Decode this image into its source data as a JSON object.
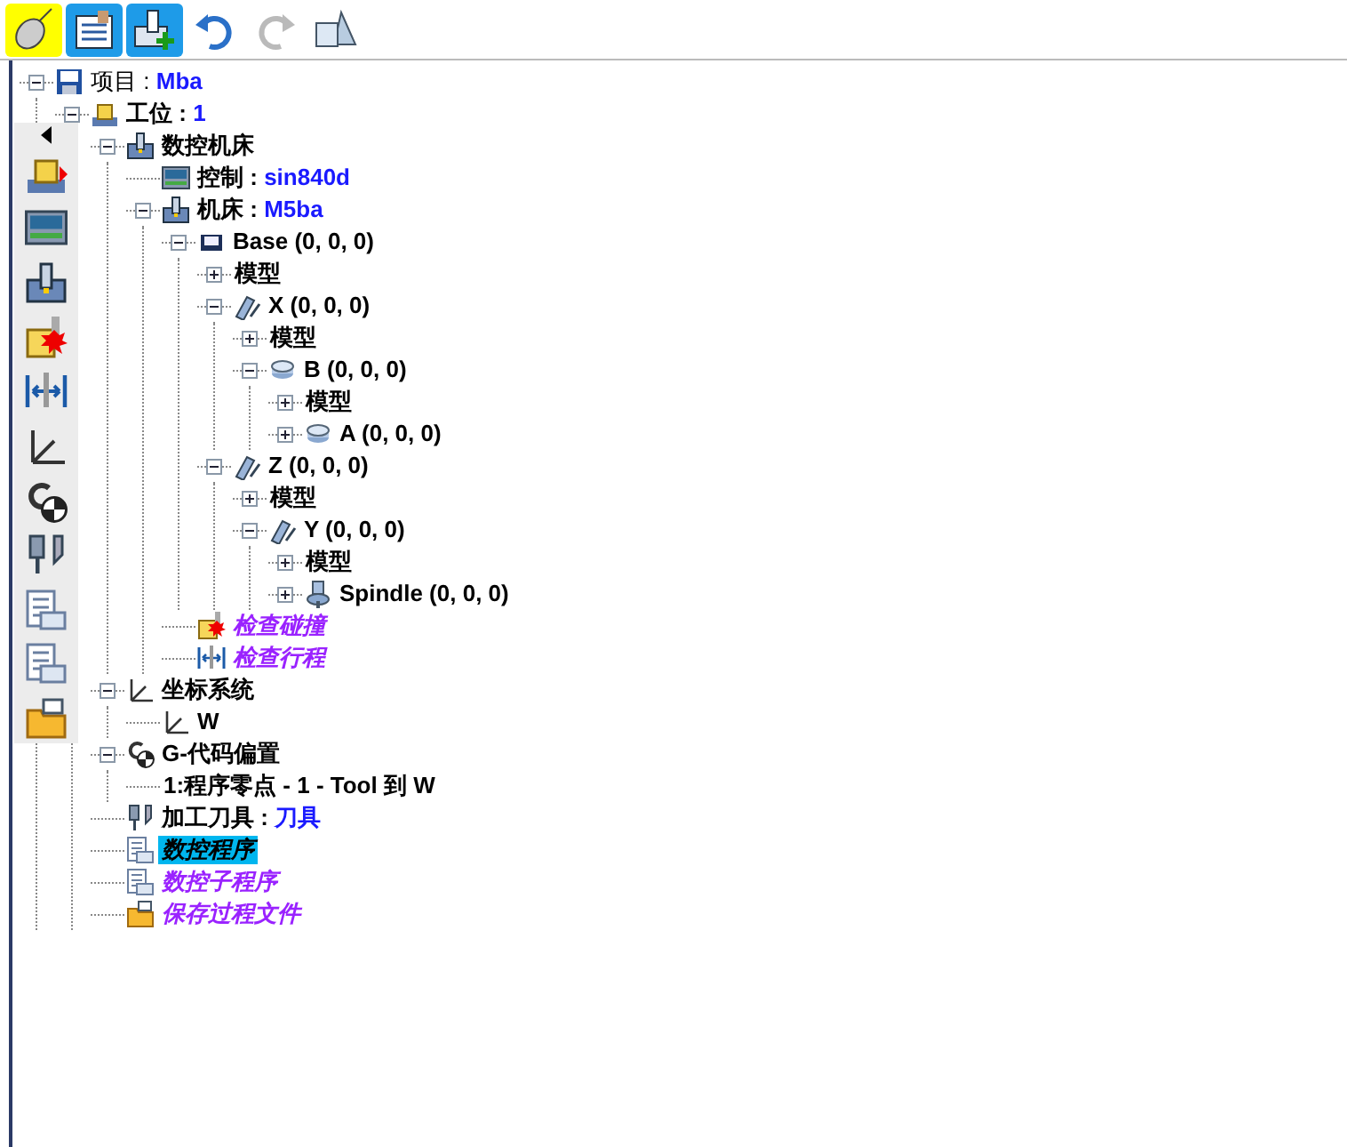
{
  "toolbar": [
    {
      "kind": "mouse",
      "on": true,
      "disabled": false
    },
    {
      "kind": "document",
      "on": false,
      "disabled": false
    },
    {
      "kind": "add-machine",
      "on": false,
      "disabled": false
    },
    {
      "kind": "undo",
      "on": false,
      "disabled": false
    },
    {
      "kind": "redo",
      "on": false,
      "disabled": true
    },
    {
      "kind": "shapes",
      "on": false,
      "disabled": false
    }
  ],
  "tree": [
    {
      "kind": "project",
      "label": "项目 :",
      "value": "Mba",
      "selected": false,
      "expanded": true,
      "children": [
        {
          "kind": "station",
          "label": "工位 :",
          "value": "1",
          "selected": false,
          "expanded": true,
          "children": [
            {
              "kind": "machine",
              "label": "数控机床",
              "selected": false,
              "expanded": true,
              "children": [
                {
                  "kind": "controller",
                  "label": "控制 :",
                  "value": "sin840d",
                  "selected": false
                },
                {
                  "kind": "machine",
                  "label": "机床 :",
                  "value": "M5ba",
                  "selected": false,
                  "expanded": true,
                  "children": [
                    {
                      "kind": "base",
                      "label": "Base (0, 0, 0)",
                      "selected": false,
                      "expanded": true,
                      "children": [
                        {
                          "kind": "model",
                          "label": "模型",
                          "selected": false,
                          "expanded": false
                        },
                        {
                          "kind": "linear",
                          "label": "X (0, 0, 0)",
                          "selected": false,
                          "expanded": true,
                          "children": [
                            {
                              "kind": "model",
                              "label": "模型",
                              "selected": false,
                              "expanded": false
                            },
                            {
                              "kind": "rotary",
                              "label": "B (0, 0, 0)",
                              "selected": false,
                              "expanded": true,
                              "children": [
                                {
                                  "kind": "model",
                                  "label": "模型",
                                  "selected": false,
                                  "expanded": false
                                },
                                {
                                  "kind": "rotary",
                                  "label": "A (0, 0, 0)",
                                  "selected": false,
                                  "expanded": false
                                }
                              ]
                            }
                          ]
                        },
                        {
                          "kind": "linear",
                          "label": "Z (0, 0, 0)",
                          "selected": false,
                          "expanded": true,
                          "children": [
                            {
                              "kind": "model",
                              "label": "模型",
                              "selected": false,
                              "expanded": false
                            },
                            {
                              "kind": "linear",
                              "label": "Y (0, 0, 0)",
                              "selected": false,
                              "expanded": true,
                              "children": [
                                {
                                  "kind": "model",
                                  "label": "模型",
                                  "selected": false,
                                  "expanded": false
                                },
                                {
                                  "kind": "spindle",
                                  "label": "Spindle (0, 0, 0)",
                                  "selected": false,
                                  "expanded": false
                                }
                              ]
                            }
                          ]
                        }
                      ]
                    },
                    {
                      "kind": "collision",
                      "label": "检查碰撞",
                      "selected": false
                    },
                    {
                      "kind": "travel",
                      "label": "检查行程",
                      "selected": false
                    }
                  ]
                }
              ]
            },
            {
              "kind": "axes",
              "label": "坐标系统",
              "selected": false,
              "expanded": true,
              "children": [
                {
                  "kind": "axes",
                  "label": "W",
                  "selected": false
                }
              ]
            },
            {
              "kind": "gcode",
              "label": "G-代码偏置",
              "selected": false,
              "expanded": true,
              "children": [
                {
                  "kind": "offset",
                  "label": "1:程序零点 - 1 - Tool 到 W",
                  "selected": false
                }
              ]
            },
            {
              "kind": "tools",
              "label": "加工刀具 :",
              "value": "刀具",
              "selected": false
            },
            {
              "kind": "nc",
              "label": "数控程序",
              "selected": true
            },
            {
              "kind": "sub",
              "label": "数控子程序",
              "selected": false
            },
            {
              "kind": "folder",
              "label": "保存过程文件",
              "selected": false
            }
          ]
        }
      ]
    }
  ]
}
